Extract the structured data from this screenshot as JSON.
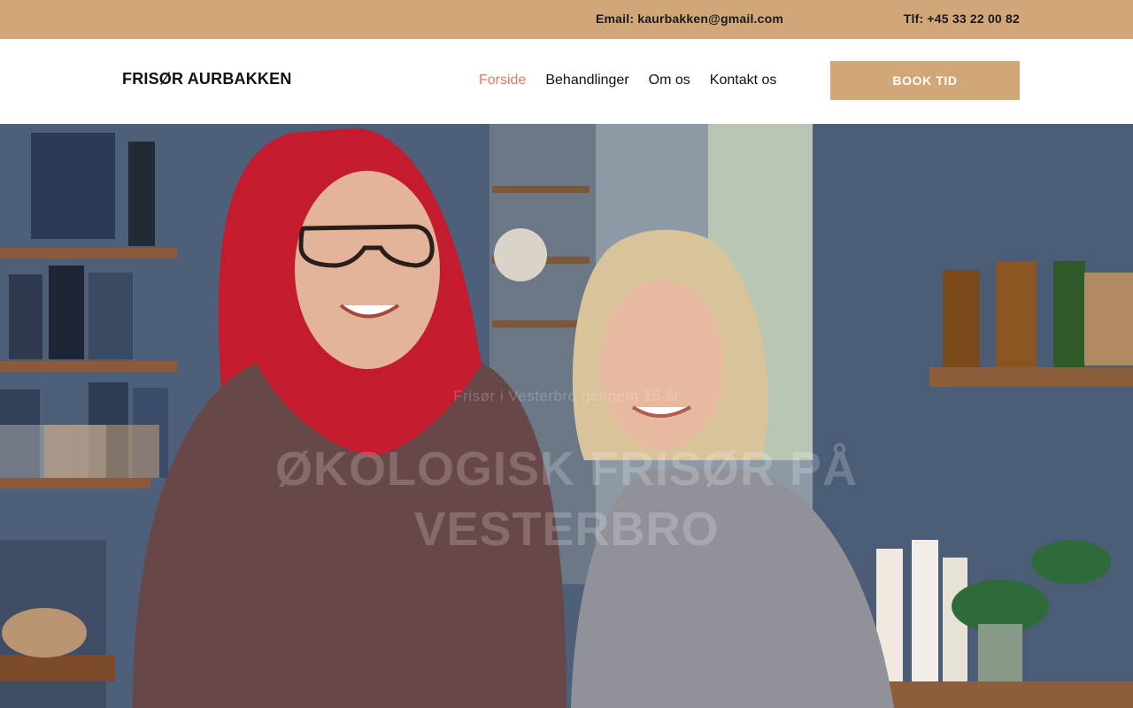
{
  "topbar": {
    "email": "Email: kaurbakken@gmail.com",
    "phone": "Tlf: +45 33 22 00 82",
    "background": "#d1a679"
  },
  "header": {
    "logo": "FRISØR AURBAKKEN",
    "nav": [
      {
        "label": "Forside",
        "active": true
      },
      {
        "label": "Behandlinger",
        "active": false
      },
      {
        "label": "Om os",
        "active": false
      },
      {
        "label": "Kontakt os",
        "active": false
      }
    ],
    "book_button": "BOOK TID",
    "active_color": "#e0795a",
    "accent": "#d1a679"
  },
  "hero": {
    "subtitle": "Frisør i Vesterbro gennem 15 år",
    "title": "ØKOLOGISK FRISØR PÅ VESTERBRO"
  }
}
